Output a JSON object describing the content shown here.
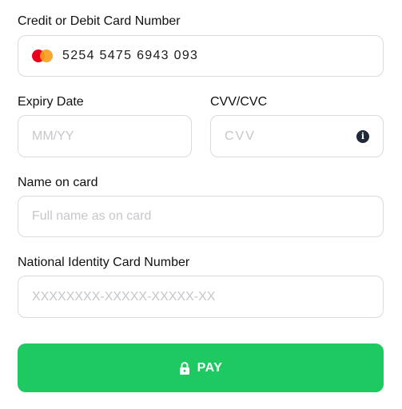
{
  "card": {
    "label": "Credit or Debit Card Number",
    "value": "5254 5475 6943 093",
    "brand_icon": "mastercard-icon",
    "brand_colors": [
      "#eb001b",
      "#f79e1b"
    ]
  },
  "expiry": {
    "label": "Expiry Date",
    "placeholder": "MM/YY"
  },
  "cvv": {
    "label": "CVV/CVC",
    "placeholder": "CVV",
    "info_icon_glyph": "i"
  },
  "name": {
    "label": "Name on card",
    "placeholder": "Full name as on card"
  },
  "nic": {
    "label": "National Identity Card Number",
    "placeholder": "XXXXXXXX-XXXXX-XXXXX-XX"
  },
  "pay": {
    "label": "PAY",
    "icon": "lock-icon",
    "color": "#1ec961"
  }
}
